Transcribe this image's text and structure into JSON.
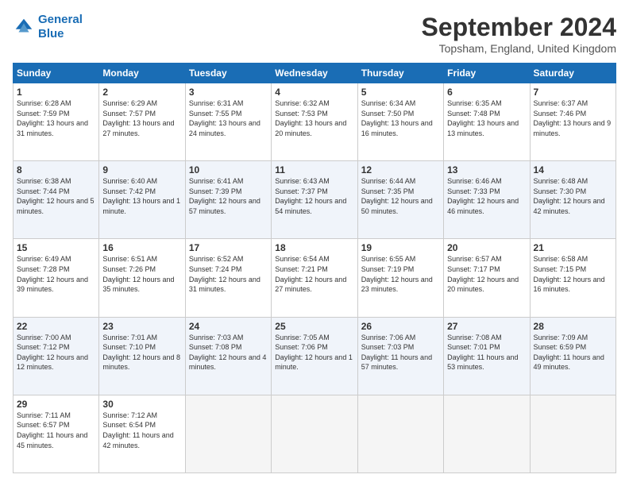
{
  "logo": {
    "line1": "General",
    "line2": "Blue"
  },
  "title": "September 2024",
  "location": "Topsham, England, United Kingdom",
  "days_of_week": [
    "Sunday",
    "Monday",
    "Tuesday",
    "Wednesday",
    "Thursday",
    "Friday",
    "Saturday"
  ],
  "weeks": [
    [
      {
        "day": "1",
        "sunrise": "6:28 AM",
        "sunset": "7:59 PM",
        "daylight": "13 hours and 31 minutes."
      },
      {
        "day": "2",
        "sunrise": "6:29 AM",
        "sunset": "7:57 PM",
        "daylight": "13 hours and 27 minutes."
      },
      {
        "day": "3",
        "sunrise": "6:31 AM",
        "sunset": "7:55 PM",
        "daylight": "13 hours and 24 minutes."
      },
      {
        "day": "4",
        "sunrise": "6:32 AM",
        "sunset": "7:53 PM",
        "daylight": "13 hours and 20 minutes."
      },
      {
        "day": "5",
        "sunrise": "6:34 AM",
        "sunset": "7:50 PM",
        "daylight": "13 hours and 16 minutes."
      },
      {
        "day": "6",
        "sunrise": "6:35 AM",
        "sunset": "7:48 PM",
        "daylight": "13 hours and 13 minutes."
      },
      {
        "day": "7",
        "sunrise": "6:37 AM",
        "sunset": "7:46 PM",
        "daylight": "13 hours and 9 minutes."
      }
    ],
    [
      {
        "day": "8",
        "sunrise": "6:38 AM",
        "sunset": "7:44 PM",
        "daylight": "12 hours and 5 minutes."
      },
      {
        "day": "9",
        "sunrise": "6:40 AM",
        "sunset": "7:42 PM",
        "daylight": "13 hours and 1 minute."
      },
      {
        "day": "10",
        "sunrise": "6:41 AM",
        "sunset": "7:39 PM",
        "daylight": "12 hours and 57 minutes."
      },
      {
        "day": "11",
        "sunrise": "6:43 AM",
        "sunset": "7:37 PM",
        "daylight": "12 hours and 54 minutes."
      },
      {
        "day": "12",
        "sunrise": "6:44 AM",
        "sunset": "7:35 PM",
        "daylight": "12 hours and 50 minutes."
      },
      {
        "day": "13",
        "sunrise": "6:46 AM",
        "sunset": "7:33 PM",
        "daylight": "12 hours and 46 minutes."
      },
      {
        "day": "14",
        "sunrise": "6:48 AM",
        "sunset": "7:30 PM",
        "daylight": "12 hours and 42 minutes."
      }
    ],
    [
      {
        "day": "15",
        "sunrise": "6:49 AM",
        "sunset": "7:28 PM",
        "daylight": "12 hours and 39 minutes."
      },
      {
        "day": "16",
        "sunrise": "6:51 AM",
        "sunset": "7:26 PM",
        "daylight": "12 hours and 35 minutes."
      },
      {
        "day": "17",
        "sunrise": "6:52 AM",
        "sunset": "7:24 PM",
        "daylight": "12 hours and 31 minutes."
      },
      {
        "day": "18",
        "sunrise": "6:54 AM",
        "sunset": "7:21 PM",
        "daylight": "12 hours and 27 minutes."
      },
      {
        "day": "19",
        "sunrise": "6:55 AM",
        "sunset": "7:19 PM",
        "daylight": "12 hours and 23 minutes."
      },
      {
        "day": "20",
        "sunrise": "6:57 AM",
        "sunset": "7:17 PM",
        "daylight": "12 hours and 20 minutes."
      },
      {
        "day": "21",
        "sunrise": "6:58 AM",
        "sunset": "7:15 PM",
        "daylight": "12 hours and 16 minutes."
      }
    ],
    [
      {
        "day": "22",
        "sunrise": "7:00 AM",
        "sunset": "7:12 PM",
        "daylight": "12 hours and 12 minutes."
      },
      {
        "day": "23",
        "sunrise": "7:01 AM",
        "sunset": "7:10 PM",
        "daylight": "12 hours and 8 minutes."
      },
      {
        "day": "24",
        "sunrise": "7:03 AM",
        "sunset": "7:08 PM",
        "daylight": "12 hours and 4 minutes."
      },
      {
        "day": "25",
        "sunrise": "7:05 AM",
        "sunset": "7:06 PM",
        "daylight": "12 hours and 1 minute."
      },
      {
        "day": "26",
        "sunrise": "7:06 AM",
        "sunset": "7:03 PM",
        "daylight": "11 hours and 57 minutes."
      },
      {
        "day": "27",
        "sunrise": "7:08 AM",
        "sunset": "7:01 PM",
        "daylight": "11 hours and 53 minutes."
      },
      {
        "day": "28",
        "sunrise": "7:09 AM",
        "sunset": "6:59 PM",
        "daylight": "11 hours and 49 minutes."
      }
    ],
    [
      {
        "day": "29",
        "sunrise": "7:11 AM",
        "sunset": "6:57 PM",
        "daylight": "11 hours and 45 minutes."
      },
      {
        "day": "30",
        "sunrise": "7:12 AM",
        "sunset": "6:54 PM",
        "daylight": "11 hours and 42 minutes."
      },
      null,
      null,
      null,
      null,
      null
    ]
  ]
}
